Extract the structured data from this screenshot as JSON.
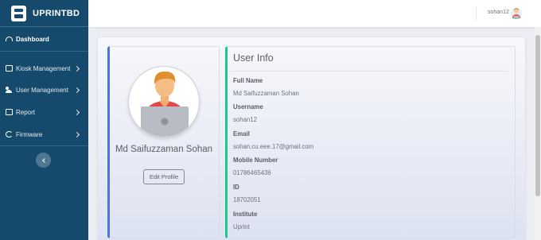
{
  "brand": {
    "name": "UPRINTBD"
  },
  "sidebar": {
    "items": [
      {
        "label": "Dashboard",
        "icon": "dashboard-icon",
        "active": true
      },
      {
        "label": "Kiosk Management",
        "icon": "kiosk-icon"
      },
      {
        "label": "User Management",
        "icon": "users-icon"
      },
      {
        "label": "Report",
        "icon": "report-icon"
      },
      {
        "label": "Firmware",
        "icon": "firmware-icon"
      }
    ]
  },
  "topbar": {
    "username": "sohan12"
  },
  "profile": {
    "name": "Md Saifuzzaman Sohan",
    "edit_label": "Edit Profile"
  },
  "user_info": {
    "title": "User Info",
    "fields": [
      {
        "label": "Full Name",
        "value": "Md Saifuzzaman Sohan"
      },
      {
        "label": "Username",
        "value": "sohan12"
      },
      {
        "label": "Email",
        "value": "sohan.cu.eee.17@gmail.com"
      },
      {
        "label": "Mobile Number",
        "value": "01786465436"
      },
      {
        "label": "ID",
        "value": "18702051"
      },
      {
        "label": "Institute",
        "value": "Uprint"
      }
    ]
  },
  "colors": {
    "sidebar_bg": "#154a6c",
    "profile_accent": "#4e73df",
    "info_accent": "#1cc88a"
  }
}
